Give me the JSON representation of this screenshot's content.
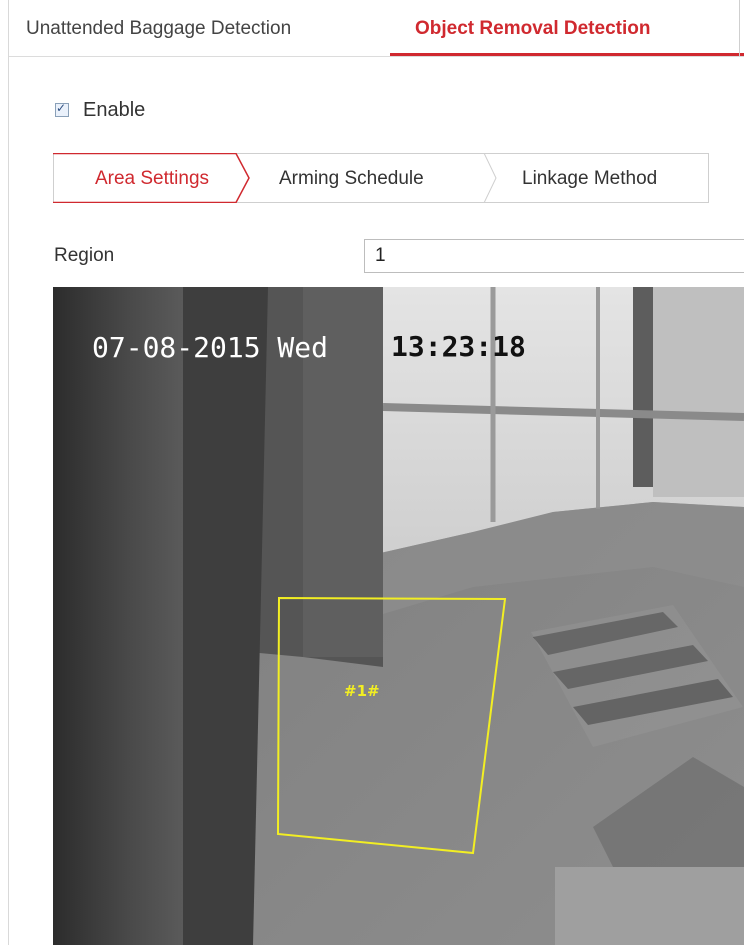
{
  "top_tabs": [
    {
      "label": "Unattended Baggage Detection",
      "active": false
    },
    {
      "label": "Object Removal Detection",
      "active": true
    }
  ],
  "enable": {
    "label": "Enable",
    "checked": true
  },
  "sub_tabs": [
    {
      "label": "Area Settings",
      "active": true
    },
    {
      "label": "Arming Schedule",
      "active": false
    },
    {
      "label": "Linkage Method",
      "active": false
    }
  ],
  "region": {
    "label": "Region",
    "value": "1"
  },
  "video": {
    "osd_date": "07-08-2015 Wed",
    "osd_time": "13:23:18",
    "region_tag": "#1#",
    "region_color": "#f2ee23"
  },
  "colors": {
    "accent": "#d0292f"
  }
}
